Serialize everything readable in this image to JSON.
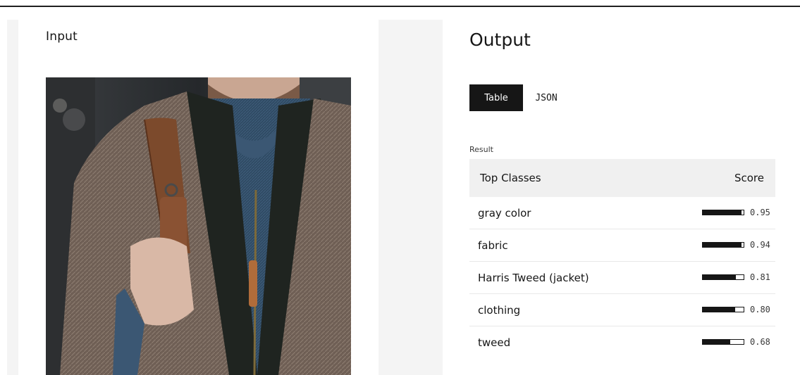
{
  "input": {
    "title": "Input"
  },
  "output": {
    "title": "Output",
    "tabs": [
      {
        "label": "Table",
        "selected": true
      },
      {
        "label": "JSON",
        "selected": false
      }
    ],
    "result_label": "Result",
    "table": {
      "headers": [
        "Top Classes",
        "Score"
      ],
      "rows": [
        {
          "label": "gray color",
          "score": "0.95",
          "value": 0.95
        },
        {
          "label": "fabric",
          "score": "0.94",
          "value": 0.94
        },
        {
          "label": "Harris Tweed (jacket)",
          "score": "0.81",
          "value": 0.81
        },
        {
          "label": "clothing",
          "score": "0.80",
          "value": 0.8
        },
        {
          "label": "tweed",
          "score": "0.68",
          "value": 0.68
        }
      ]
    }
  },
  "colors": {
    "primary": "#161616",
    "header_bg": "#f0f0f0",
    "strip_bg": "#f4f4f4"
  }
}
